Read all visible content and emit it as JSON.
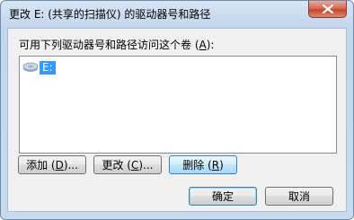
{
  "window": {
    "title": "更改 E: (共享的扫描仪) 的驱动器号和路径",
    "close_glyph": "×"
  },
  "group": {
    "label_prefix": "可用下列驱动器号和路径访问这个卷 (",
    "label_mnemonic": "A",
    "label_suffix": "):"
  },
  "list": {
    "items": [
      {
        "label": "E:",
        "icon": "drive-icon",
        "selected": true
      }
    ]
  },
  "buttons": {
    "add": {
      "prefix": "添加 (",
      "mnemonic": "D",
      "suffix": ")..."
    },
    "change": {
      "prefix": "更改 (",
      "mnemonic": "C",
      "suffix": ")..."
    },
    "remove": {
      "prefix": "删除 (",
      "mnemonic": "R",
      "suffix": ")"
    },
    "ok": "确定",
    "cancel": "取消"
  },
  "colors": {
    "selection": "#3399ff",
    "titlebar": "#c4d6ec",
    "close_button": "#c7452f"
  }
}
